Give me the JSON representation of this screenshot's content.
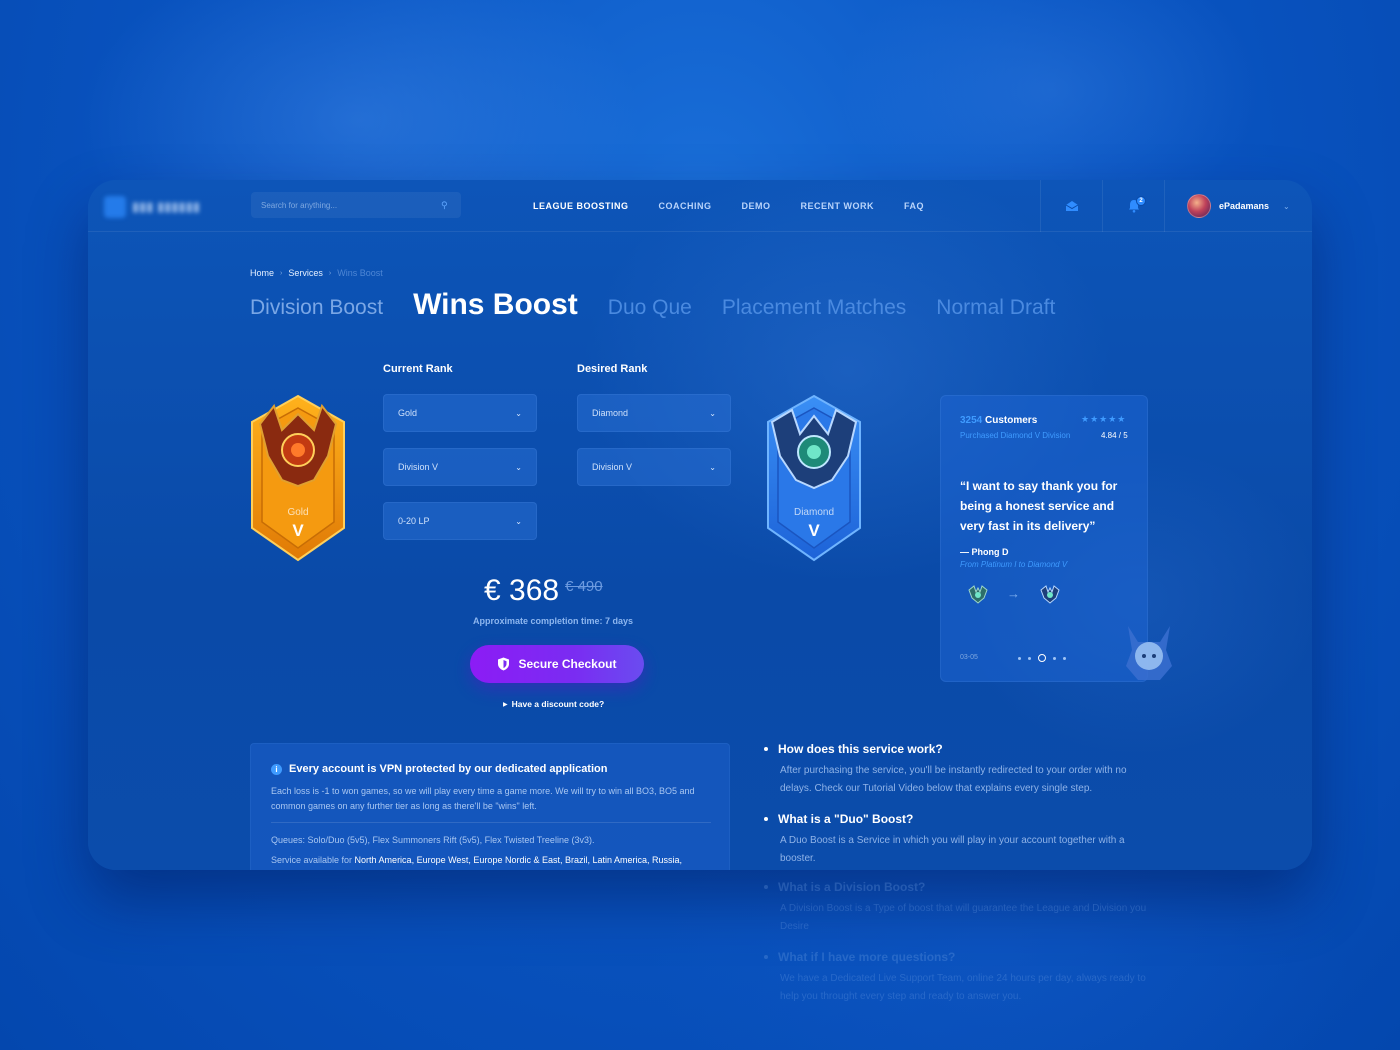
{
  "nav": {
    "search_placeholder": "Search for anything...",
    "items": [
      {
        "label": "LEAGUE BOOSTING"
      },
      {
        "label": "COACHING"
      },
      {
        "label": "DEMO"
      },
      {
        "label": "RECENT WORK"
      },
      {
        "label": "FAQ"
      }
    ],
    "notification_count": "2",
    "username": "ePadamans"
  },
  "breadcrumb": [
    "Home",
    "Services",
    "Wins Boost"
  ],
  "tabs": [
    "Division Boost",
    "Wins Boost",
    "Duo Que",
    "Placement Matches",
    "Normal Draft"
  ],
  "form": {
    "current_label": "Current Rank",
    "desired_label": "Desired Rank",
    "current_rank": "Gold",
    "current_division": "Division V",
    "current_lp": "0-20 LP",
    "desired_rank": "Diamond",
    "desired_division": "Division V"
  },
  "badges": {
    "current": {
      "name": "Gold",
      "tier": "V",
      "color": "#f59a10"
    },
    "desired": {
      "name": "Diamond",
      "tier": "V",
      "color": "#2f7fe8"
    }
  },
  "price": {
    "now": "€ 368",
    "old": "€ 490",
    "eta": "Approximate completion time: 7 days"
  },
  "checkout": {
    "label": "Secure Checkout",
    "discount": "Have a discount code?"
  },
  "testimonial": {
    "count": "3254",
    "count_label": " Customers",
    "stars": "★★★★★",
    "purchased": "Purchased Diamond V Division",
    "rating": "4.84 / 5",
    "quote": "“I want to say thank you for being a honest service and very fast in its delivery”",
    "author": "— Phong D",
    "route": "From Platinum I to Diamond V",
    "date": "03-05"
  },
  "info": {
    "title": "Every account is VPN protected by our dedicated application",
    "body": "Each loss is -1 to won games, so we will play every time a game more. We will try to win all BO3, BO5 and common games on any further tier as long as there'll be \"wins\" left.",
    "queues": "Queues: Solo/Duo (5v5), Flex Summoners Rift (5v5), Flex Twisted Treeline (3v3).",
    "regions_prefix": "Service available for ",
    "regions": "North America, Europe West, Europe Nordic & East, Brazil, Latin America, Russia,"
  },
  "faq": [
    {
      "q": "How does this service work?",
      "a": "After purchasing the service, you'll be instantly redirected to your order with no delays. Check our Tutorial Video below that explains every single step."
    },
    {
      "q": "What is a \"Duo\" Boost?",
      "a": "A Duo Boost is a Service in which you will play in your account together with a booster."
    },
    {
      "q": "What is a Division Boost?",
      "a": "A Division Boost is a Type of boost that will guarantee the League and Division you Desire"
    },
    {
      "q": "What if I have more questions?",
      "a": "We have a Dedicated Live Support Team, online 24 hours per day, always ready to help you throught every step and ready to answer you."
    }
  ],
  "colors": {
    "accent": "#3f9bff",
    "checkout": "#8c1cf5",
    "gold": "#f59a10",
    "diamond": "#2f7fe8"
  }
}
